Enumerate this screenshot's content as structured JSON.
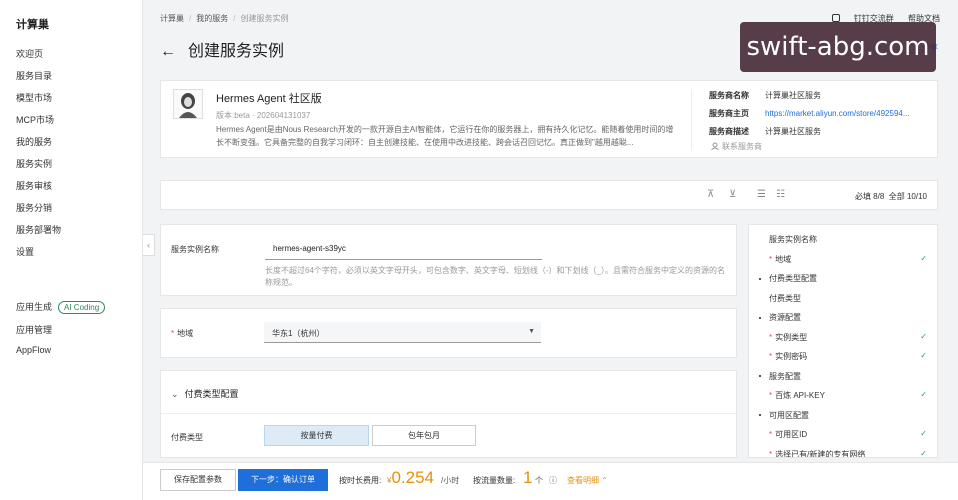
{
  "sidebar": {
    "brand": "计算巢",
    "items": [
      "欢迎页",
      "服务目录",
      "模型市场",
      "MCP市场",
      "我的服务",
      "服务实例",
      "服务审核",
      "服务分销",
      "服务部署物",
      "设置"
    ],
    "bottom_items": [
      "应用生成",
      "应用管理",
      "AppFlow"
    ],
    "ai_badge": "AI Coding",
    "collapse_icon": "‹"
  },
  "header": {
    "breadcrumb": [
      "计算巢",
      "我的服务",
      "创建服务实例"
    ],
    "breadcrumb_sep": "/",
    "links": [
      "钉钉交流群",
      "帮助文档"
    ],
    "link_icons": [
      "dingtalk-icon",
      "help-icon"
    ],
    "title": "创建服务实例",
    "back_icon": "←",
    "share": "分享"
  },
  "watermark": "swift-abg.com",
  "service": {
    "name": "Hermes Agent 社区版",
    "version": "版本:beta · 202604131037",
    "description": "Hermes Agent是由Nous Research开发的一款开源自主AI智能体，它运行在你的服务器上，拥有持久化记忆。能随着使用时间的增长不断变强。它具备完整的自我学习闭环：自主创建技能、在使用中改进技能、跨会话召回记忆。真正做到\"越用越聪...",
    "provider_label": "服务商名称",
    "provider": "计算巢社区服务",
    "homepage_label": "服务商主页",
    "homepage": "https://market.aliyun.com/store/492594...",
    "desc_label": "服务商描述",
    "provider_desc": "计算巢社区服务",
    "contact": "联系服务商"
  },
  "toolbar": {
    "icons": [
      "⊼",
      "⊻",
      "☰",
      "☷"
    ],
    "icon_names": [
      "collapse-all-icon",
      "expand-all-icon",
      "list-view-icon",
      "grid-view-icon"
    ],
    "required_count": "必填 8/8",
    "total_count": "全部 10/10"
  },
  "form": {
    "name_label": "服务实例名称",
    "name_value": "hermes-agent-s39yc",
    "name_hint": "长度不超过64个字符，必须以英文字母开头，可包含数字、英文字母、短划线（-）和下划线（_）。且需符合服务中定义的资源的名称规范。",
    "region_label": "地域",
    "region_value": "华东1（杭州）",
    "region_arrow": "▼",
    "pay_section": "付费类型配置",
    "pay_chevron": "⌄",
    "pay_label": "付费类型",
    "pay_options": [
      "按量付费",
      "包年包月"
    ],
    "required_mark": "*"
  },
  "side_panel": {
    "items": [
      {
        "text": "服务实例名称",
        "kind": "plain",
        "check": false
      },
      {
        "text": "地域",
        "kind": "sub",
        "check": true
      },
      {
        "text": "付费类型配置",
        "kind": "group",
        "check": false
      },
      {
        "text": "付费类型",
        "kind": "plain",
        "check": false
      },
      {
        "text": "资源配置",
        "kind": "group",
        "check": false
      },
      {
        "text": "实例类型",
        "kind": "sub",
        "check": true
      },
      {
        "text": "实例密码",
        "kind": "sub",
        "check": true
      },
      {
        "text": "服务配置",
        "kind": "group",
        "check": false
      },
      {
        "text": "百炼 API-KEY",
        "kind": "sub",
        "check": true
      },
      {
        "text": "可用区配置",
        "kind": "group",
        "check": false
      },
      {
        "text": "可用区ID",
        "kind": "sub",
        "check": true
      },
      {
        "text": "选择已有/新建的专有网络",
        "kind": "sub",
        "check": true
      }
    ],
    "check_mark": "✓",
    "required_mark": "*"
  },
  "bottom": {
    "save_label": "保存配置参数",
    "next_label": "下一步：确认订单",
    "price_label": "按时长费用:",
    "currency": "¥",
    "price": "0.254",
    "price_unit": "/小时",
    "traffic_label": "按流量数量:",
    "traffic_value": "1",
    "traffic_unit": "个",
    "help_icon": "ⓘ",
    "details_label": "查看明细 ⌃"
  },
  "colors": {
    "primary": "#1e6fd9",
    "price": "#e8900c",
    "check": "#2d9a5a",
    "required": "#e34d4d"
  }
}
